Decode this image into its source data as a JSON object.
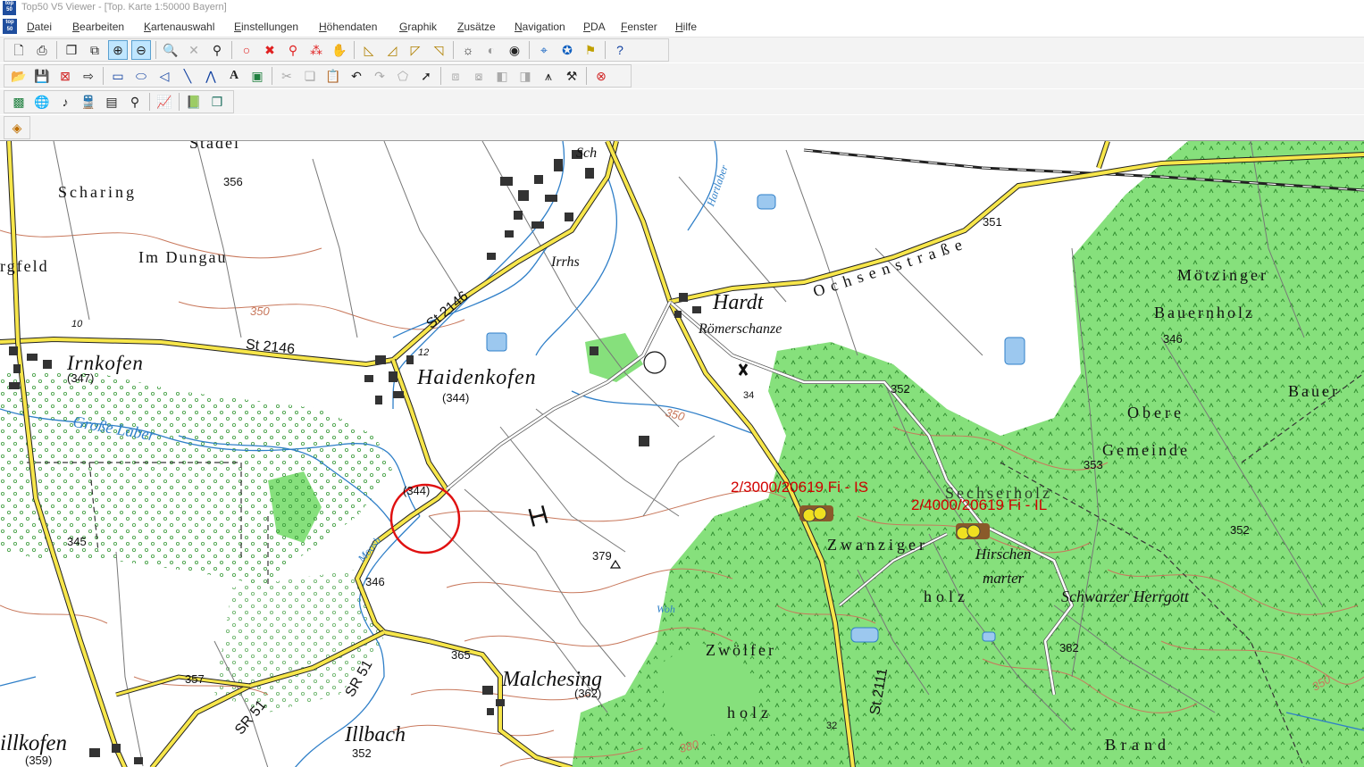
{
  "window": {
    "title": "Top50 V5 Viewer - [Top. Karte 1:50000 Bayern]",
    "app_icon_text": "top 50"
  },
  "menu": {
    "items": [
      "Datei",
      "Bearbeiten",
      "Kartenauswahl",
      "Einstellungen",
      "Höhendaten",
      "Graphik",
      "Zusätze",
      "Navigation",
      "PDA",
      "Fenster",
      "Hilfe"
    ]
  },
  "toolbars": {
    "row1": [
      "new-file-icon",
      "print-icon",
      "copy-icon",
      "copy-window-icon",
      "zoom-in-box-icon",
      "zoom-out-box-icon",
      "zoom-in-icon",
      "zoom-reset-icon",
      "zoom-out-icon",
      "point-icon",
      "delete-point-icon",
      "pin-icon",
      "multi-pin-icon",
      "pan-hand-icon",
      "ruler-icon",
      "ruler-edit-icon",
      "ruler-info-icon",
      "ruler-area-icon",
      "brightness-icon",
      "contrast-icon",
      "dot-icon",
      "gps-icon",
      "compass-icon",
      "map-flag-icon",
      "help-icon"
    ],
    "row2": [
      "open-icon",
      "save-icon",
      "delete-file-icon",
      "export-icon",
      "rectangle-icon",
      "ellipse-icon",
      "polygon-icon",
      "line-icon",
      "polyline-icon",
      "text-icon",
      "image-icon",
      "cut-icon",
      "copy2-icon",
      "paste-icon",
      "undo-icon",
      "redo-icon",
      "edit-shape-icon",
      "select-icon",
      "group-icon",
      "ungroup-icon",
      "front-icon",
      "back-icon",
      "align-icon",
      "tool-icon",
      "delete-object-icon"
    ],
    "row3": [
      "map-overview-icon",
      "globe-icon",
      "music-note-icon",
      "train-icon",
      "photo-series-icon",
      "search-icon",
      "profile-chart-icon",
      "book-icon",
      "layers-icon"
    ],
    "row4": [
      "map-layer-icon"
    ]
  },
  "map": {
    "place_names": {
      "stadel": "Stadel",
      "scharing": "Scharing",
      "im_dungau": "Im Dungau",
      "rgfeld": "rgfeld",
      "irnkofen": "Irnkofen",
      "haidenkofen": "Haidenkofen",
      "hardt": "Hardt",
      "roemerschanze": "Römerschanze",
      "ochsenstrasse": "Ochsenstraße",
      "moetzinger": "Mötzinger",
      "bauernholz": "Bauernholz",
      "bauer": "Bauer",
      "obere": "Obere",
      "gemeinde": "Gemeinde",
      "zwanziger": "Zwanziger",
      "sechserholz": "Sechserholz",
      "hirschen": "Hirschen",
      "marter": "marter",
      "schwarzer_herrgott": "Schwarzer Herrgott",
      "holz1": "holz",
      "zwoelfer": "Zwölfer",
      "holz2": "holz",
      "malchesing": "Malchesing",
      "illbach": "Illbach",
      "illkofen": "illkofen",
      "brand": "Brand",
      "grosse_laber": "Große Laber",
      "hartlaber": "Hartlaber",
      "irrhs": "Irrhs",
      "moosb": "Moosb",
      "woh": "Woh",
      "sch": "Sch"
    },
    "road_labels": {
      "st2146_a": "St 2146",
      "st2146_b": "St 2146",
      "sr51_a": "SR 51",
      "sr51_b": "SR 51",
      "st2111": "St 2111"
    },
    "elevations": {
      "e356": "356",
      "e351": "351",
      "e350a": "350",
      "e347": "(347)",
      "e344a": "(344)",
      "e344b": "(344)",
      "e352a": "352",
      "e346a": "346",
      "e345": "345",
      "e346b": "346",
      "e379": "379",
      "e365": "365",
      "e357": "357",
      "e362": "(362)",
      "e359": "(359)",
      "e352b": "352",
      "e353": "353",
      "e352c": "352",
      "e382": "382",
      "e350b": "350",
      "e380": "380",
      "e350c": "350",
      "e34": "34",
      "e32": "32",
      "e10": "10",
      "e12": "12"
    },
    "markers": [
      {
        "label": "2/3000/20619   Fi - IS"
      },
      {
        "label": "2/4000/20619   Fi - IL"
      }
    ],
    "colors": {
      "forest": "#86e07c",
      "main_road": "#f7e64a",
      "water": "#2f7fc8",
      "contour": "#c8785c",
      "marker_label": "#d20000",
      "circle": "#e01010"
    }
  }
}
